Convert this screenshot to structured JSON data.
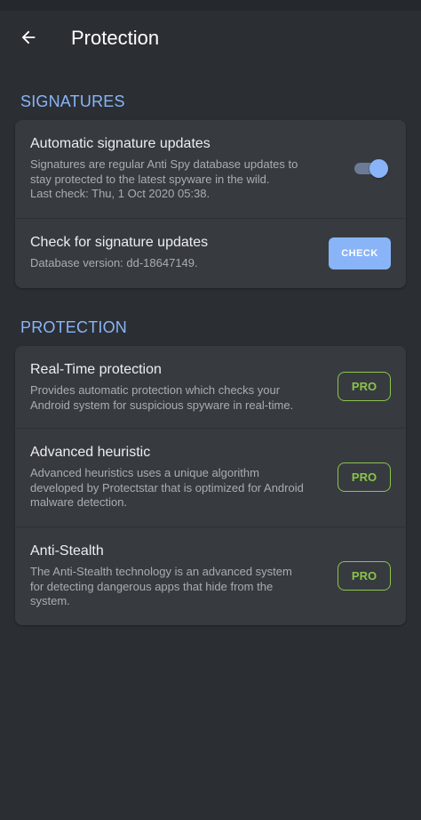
{
  "header": {
    "title": "Protection",
    "back_icon": "arrow-left-icon"
  },
  "sections": [
    {
      "title": "SIGNATURES",
      "rows": [
        {
          "title": "Automatic signature updates",
          "desc": "Signatures are regular Anti Spy database updates to\nstay protected to the latest spyware in the wild.\nLast check: Thu, 1 Oct 2020 05:38.",
          "control": "toggle",
          "toggle_on": true
        },
        {
          "title": "Check for signature updates",
          "desc": "Database version: dd-18647149.",
          "control": "button",
          "button_label": "CHECK"
        }
      ]
    },
    {
      "title": "PROTECTION",
      "rows": [
        {
          "title": "Real-Time protection",
          "desc": "Provides automatic protection which checks your\nAndroid system for suspicious spyware in real-time.",
          "control": "badge",
          "button_label": "PRO"
        },
        {
          "title": "Advanced heuristic",
          "desc": "Advanced heuristics uses a unique algorithm\ndeveloped by Protectstar that is optimized for Android\nmalware detection.",
          "control": "badge",
          "button_label": "PRO"
        },
        {
          "title": "Anti-Stealth",
          "desc": "The Anti-Stealth technology is an advanced system\nfor detecting dangerous apps that hide from the\nsystem.",
          "control": "badge",
          "button_label": "PRO"
        }
      ]
    }
  ],
  "colors": {
    "background": "#2b2f33",
    "card": "#373b40",
    "accent_blue": "#8ab4f8",
    "pro_green": "#8bc34a"
  }
}
